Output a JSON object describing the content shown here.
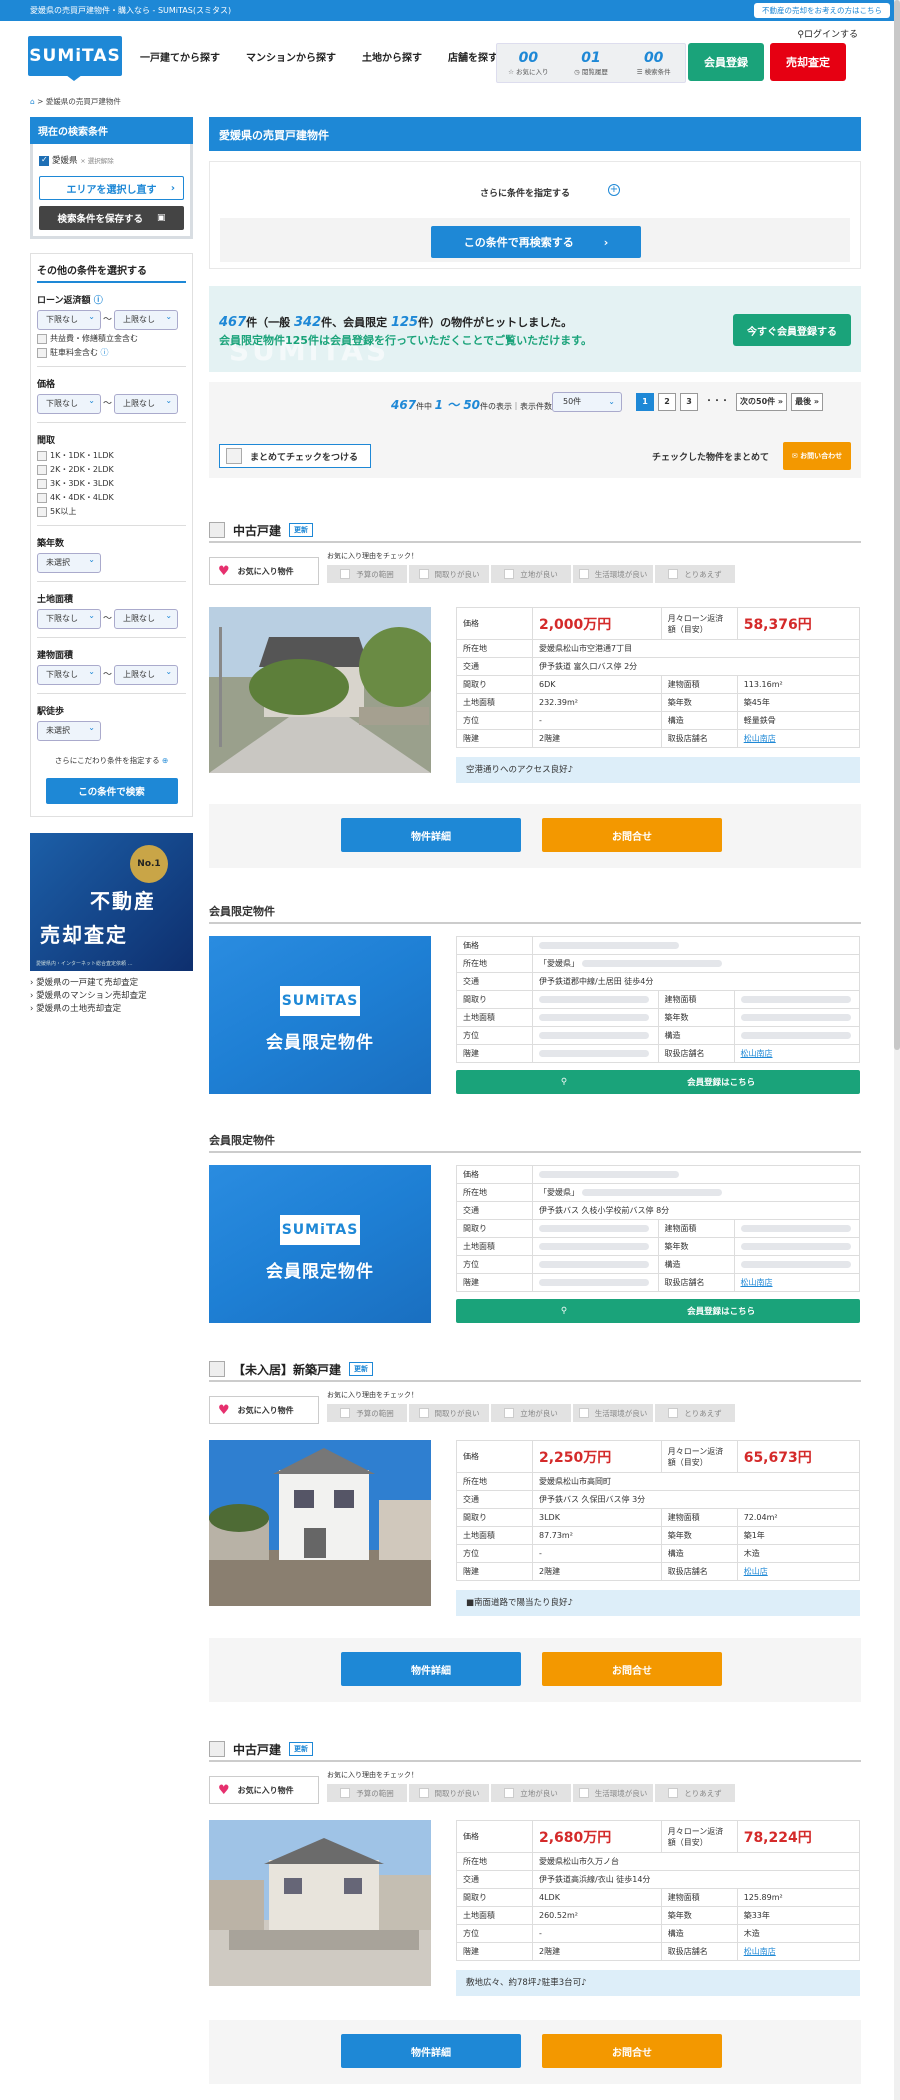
{
  "topbar": {
    "text": "愛媛県の売買戸建物件・購入なら - SUMiTAS(スミタス)",
    "button": "不動産の売却をお考えの方はこちら"
  },
  "header": {
    "logo": "SUMiTAS",
    "nav": [
      "一戸建てから探す",
      "マンションから探す",
      "土地から探す",
      "店舗を探す"
    ],
    "login": "ログインする",
    "counters": [
      {
        "num": "00",
        "label": "お気に入り"
      },
      {
        "num": "01",
        "label": "閲覧履歴"
      },
      {
        "num": "00",
        "label": "検索条件"
      }
    ],
    "member_btn": "会員登録",
    "sell_btn": "売却査定"
  },
  "breadcrumb": "愛媛県の売買戸建物件",
  "sidebar": {
    "current_title": "現在の検索条件",
    "current_pref": "愛媛県",
    "remove": "× 選択解除",
    "reselect": "エリアを選択し直す",
    "save": "検索条件を保存する",
    "other_title": "その他の条件を選択する",
    "loan_label": "ローン返済額",
    "lower": "下限なし",
    "upper": "上限なし",
    "opt_common": "共益費・修繕積立金含む",
    "opt_parking": "駐車料金含む",
    "price_label": "価格",
    "madori_label": "間取",
    "madori": [
      "1K・1DK・1LDK",
      "2K・2DK・2LDK",
      "3K・3DK・3LDK",
      "4K・4DK・4LDK",
      "5K以上"
    ],
    "age_label": "築年数",
    "unselected": "未選択",
    "land_label": "土地面積",
    "bldg_label": "建物面積",
    "walk_label": "駅徒歩",
    "more": "さらにこだわり条件を指定する",
    "search": "この条件で検索",
    "banner_top": "不動産",
    "banner_bottom": "売却査定",
    "banner_badge": "No.1",
    "banner_note": "愛媛県内・インターネット総合査定依頼 …",
    "links": [
      "愛媛県の一戸建て売却査定",
      "愛媛県のマンション売却査定",
      "愛媛県の土地売却査定"
    ]
  },
  "main": {
    "title": "愛媛県の売買戸建物件",
    "more_cond": "さらに条件を指定する",
    "research": "この条件で再検索する",
    "hit_total": "467",
    "hit_mid1": "件（一般",
    "hit_general": "342",
    "hit_mid2": "件、会員限定",
    "hit_member": "125",
    "hit_end": "件）の物件がヒットしました。",
    "hit_line2": "会員限定物件125件は会員登録を行っていただくことでご覧いただけます。",
    "join_btn": "今すぐ会員登録する",
    "watermark": "SUMiTAS",
    "pager_total": "467",
    "pager_mid": "件中",
    "pager_range": "1 〜 50",
    "pager_suffix": "件の表示｜表示件数",
    "per_page": "50件",
    "pages": [
      "1",
      "2",
      "3",
      "・・・",
      "次の50件 »",
      "最後 »"
    ],
    "check_all": "まとめてチェックをつける",
    "checked_text": "チェックした物件をまとめて",
    "inquiry_small": "お問い合わせ"
  },
  "labels": {
    "fav": "お気に入り物件",
    "fav_q": "お気に入り理由をチェック！",
    "reasons": [
      "予算の範囲",
      "間取りが良い",
      "立地が良い",
      "生活環境が良い",
      "とりあえず"
    ],
    "price": "価格",
    "loan": "月々ローン返済額（目安）",
    "address": "所在地",
    "traffic": "交通",
    "madori": "間取り",
    "bldg_area": "建物面積",
    "land_area": "土地面積",
    "age": "築年数",
    "direction": "方位",
    "structure": "構造",
    "floor": "階建",
    "shop": "取扱店舗名",
    "detail": "物件詳細",
    "inquiry": "お問合せ",
    "member_only": "会員限定物件",
    "register": "会員登録はこちら",
    "new": "更新"
  },
  "properties": [
    {
      "type": "中古戸建",
      "price": "2,000万円",
      "loan": "58,376円",
      "address": "愛媛県松山市空港通7丁目",
      "traffic": "伊予鉄道 富久口バス停 2分",
      "madori": "6DK",
      "bldg_area": "113.16m²",
      "land_area": "232.39m²",
      "age": "築45年",
      "direction": "-",
      "structure": "軽量鉄骨",
      "floor": "2階建",
      "shop": "松山南店",
      "comment": "空港通りへのアクセス良好♪"
    },
    {
      "type": "【未入居】新築戸建",
      "price": "2,250万円",
      "loan": "65,673円",
      "address": "愛媛県松山市高岡町",
      "traffic": "伊予鉄バス 久保田バス停 3分",
      "madori": "3LDK",
      "bldg_area": "72.04m²",
      "land_area": "87.73m²",
      "age": "築1年",
      "direction": "-",
      "structure": "木造",
      "floor": "2階建",
      "shop": "松山店",
      "comment": "■南面道路で陽当たり良好♪"
    },
    {
      "type": "中古戸建",
      "price": "2,680万円",
      "loan": "78,224円",
      "address": "愛媛県松山市久万ノ台",
      "traffic": "伊予鉄道高浜線/衣山 徒歩14分",
      "madori": "4LDK",
      "bldg_area": "125.89m²",
      "land_area": "260.52m²",
      "age": "築33年",
      "direction": "-",
      "structure": "木造",
      "floor": "2階建",
      "shop": "松山南店",
      "comment": "敷地広々、約78坪♪駐車3台可♪"
    }
  ],
  "members": [
    {
      "title": "会員限定物件",
      "address": "「愛媛県」",
      "traffic": "伊予鉄道郡中線/土居田 徒歩4分",
      "shop": "松山南店"
    },
    {
      "title": "会員限定物件",
      "address": "「愛媛県」",
      "traffic": "伊予鉄バス 久枝小学校前バス停 8分",
      "shop": "松山南店"
    }
  ]
}
